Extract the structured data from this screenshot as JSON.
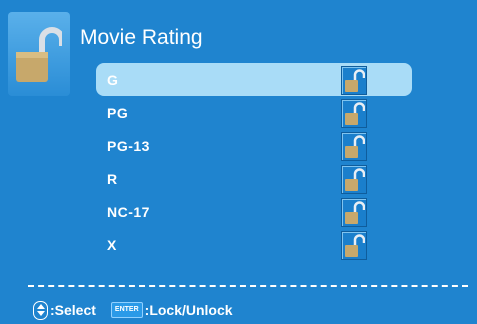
{
  "header": {
    "title": "Movie Rating",
    "icon": "unlocked-padlock-icon"
  },
  "ratings": [
    {
      "label": "G",
      "selected": true,
      "state": "unlocked"
    },
    {
      "label": "PG",
      "selected": false,
      "state": "unlocked"
    },
    {
      "label": "PG-13",
      "selected": false,
      "state": "unlocked"
    },
    {
      "label": "R",
      "selected": false,
      "state": "unlocked"
    },
    {
      "label": "NC-17",
      "selected": false,
      "state": "unlocked"
    },
    {
      "label": "X",
      "selected": false,
      "state": "unlocked"
    }
  ],
  "footer": {
    "select_label": ":Select",
    "enter_key": "ENTER",
    "lock_label": ":Lock/Unlock"
  },
  "colors": {
    "background": "#1f84cf",
    "highlight": "#a9dcf7"
  }
}
